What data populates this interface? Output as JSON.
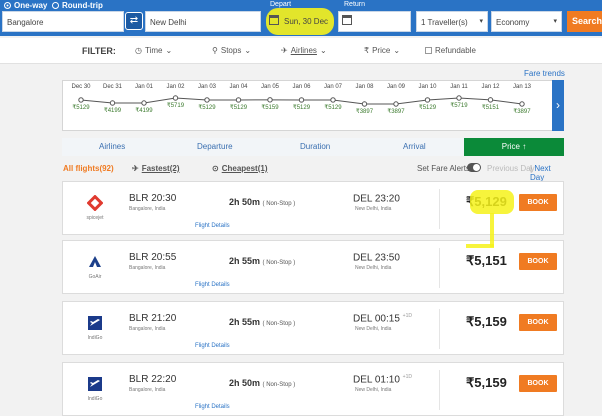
{
  "search": {
    "one_way": "One-way",
    "round_trip": "Round-trip",
    "from": "Bangalore",
    "to": "New Delhi",
    "depart_label": "Depart",
    "depart_value": "Sun, 30 Dec",
    "return_label": "Return",
    "travellers": "1 Traveller(s)",
    "cabin": "Economy",
    "search_btn": "Search"
  },
  "filter": {
    "label": "FILTER:",
    "time": "Time",
    "stops": "Stops",
    "airlines": "Airlines",
    "price": "Price",
    "refundable": "Refundable"
  },
  "fare_trends": "Fare trends",
  "fare_calendar": [
    {
      "day": "Dec 30",
      "fare": "₹5129"
    },
    {
      "day": "Dec 31",
      "fare": "₹4199"
    },
    {
      "day": "Jan 01",
      "fare": "₹4199"
    },
    {
      "day": "Jan 02",
      "fare": "₹5719"
    },
    {
      "day": "Jan 03",
      "fare": "₹5129"
    },
    {
      "day": "Jan 04",
      "fare": "₹5129"
    },
    {
      "day": "Jan 05",
      "fare": "₹5159"
    },
    {
      "day": "Jan 06",
      "fare": "₹5129"
    },
    {
      "day": "Jan 07",
      "fare": "₹5129"
    },
    {
      "day": "Jan 08",
      "fare": "₹3897"
    },
    {
      "day": "Jan 09",
      "fare": "₹3897"
    },
    {
      "day": "Jan 10",
      "fare": "₹5129"
    },
    {
      "day": "Jan 11",
      "fare": "₹5719"
    },
    {
      "day": "Jan 12",
      "fare": "₹5151"
    },
    {
      "day": "Jan 13",
      "fare": "₹3897"
    }
  ],
  "sort": {
    "airlines": "Airlines",
    "departure": "Departure",
    "duration": "Duration",
    "arrival": "Arrival",
    "price": "Price"
  },
  "summary": {
    "all_flights": "All flights(92)",
    "fastest": "Fastest(2)",
    "cheapest": "Cheapest(1)",
    "fare_alerts": "Set Fare Alerts",
    "previous_day": "Previous Day",
    "next_day": "Next Day"
  },
  "flights": [
    {
      "airline": "spicejet",
      "dep": "BLR 20:30",
      "dep_city": "Bangalore, India",
      "duration": "2h 50m",
      "stops": "( Non-Stop )",
      "arr": "DEL 23:20",
      "arr_plus": "",
      "arr_city": "New Delhi, India",
      "price": "₹5,129",
      "book": "BOOK",
      "details": "Flight Details"
    },
    {
      "airline": "GoAir",
      "dep": "BLR 20:55",
      "dep_city": "Bangalore, India",
      "duration": "2h 55m",
      "stops": "( Non-Stop )",
      "arr": "DEL 23:50",
      "arr_plus": "",
      "arr_city": "New Delhi, India",
      "price": "₹5,151",
      "book": "BOOK",
      "details": "Flight Details"
    },
    {
      "airline": "IndiGo",
      "dep": "BLR 21:20",
      "dep_city": "Bangalore, India",
      "duration": "2h 55m",
      "stops": "( Non-Stop )",
      "arr": "DEL 00:15",
      "arr_plus": "+1D",
      "arr_city": "New Delhi, India",
      "price": "₹5,159",
      "book": "BOOK",
      "details": "Flight Details"
    },
    {
      "airline": "IndiGo",
      "dep": "BLR 22:20",
      "dep_city": "Bangalore, India",
      "duration": "2h 50m",
      "stops": "( Non-Stop )",
      "arr": "DEL 01:10",
      "arr_plus": "+1D",
      "arr_city": "New Delhi, India",
      "price": "₹5,159",
      "book": "BOOK",
      "details": "Flight Details"
    }
  ],
  "colors": {
    "brand": "#2a73c5",
    "accent": "#f07b22",
    "active_sort": "#0b8a39",
    "fare_green": "#3b7a2d",
    "highlight": "#f6f21a"
  }
}
